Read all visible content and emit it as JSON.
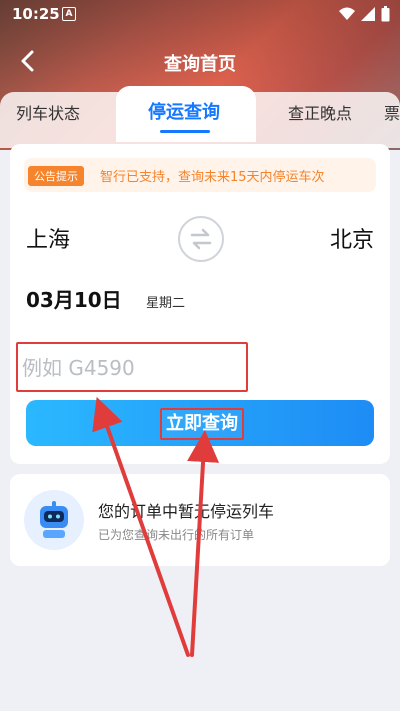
{
  "status_bar": {
    "time": "10:25",
    "a_icon": "A"
  },
  "nav": {
    "title": "查询首页"
  },
  "tabs": [
    {
      "label": "列车状态",
      "active": false
    },
    {
      "label": "停运查询",
      "active": true
    },
    {
      "label": "查正晚点",
      "active": false
    },
    {
      "label": "票",
      "active": false
    }
  ],
  "notice": {
    "badge": "公告提示",
    "text": "智行已支持，查询未来15天内停运车次"
  },
  "route": {
    "from": "上海",
    "to": "北京"
  },
  "date": {
    "value": "03月10日",
    "weekday": "星期二"
  },
  "train_input": {
    "placeholder": "例如 G4590"
  },
  "query_button": {
    "label": "立即查询"
  },
  "orders": {
    "title": "您的订单中暂无停运列车",
    "subtitle": "已为您查询未出行的所有订单"
  },
  "colors": {
    "accent": "#1677ff",
    "notice": "#f5842c",
    "annotation": "#e03c3c"
  }
}
